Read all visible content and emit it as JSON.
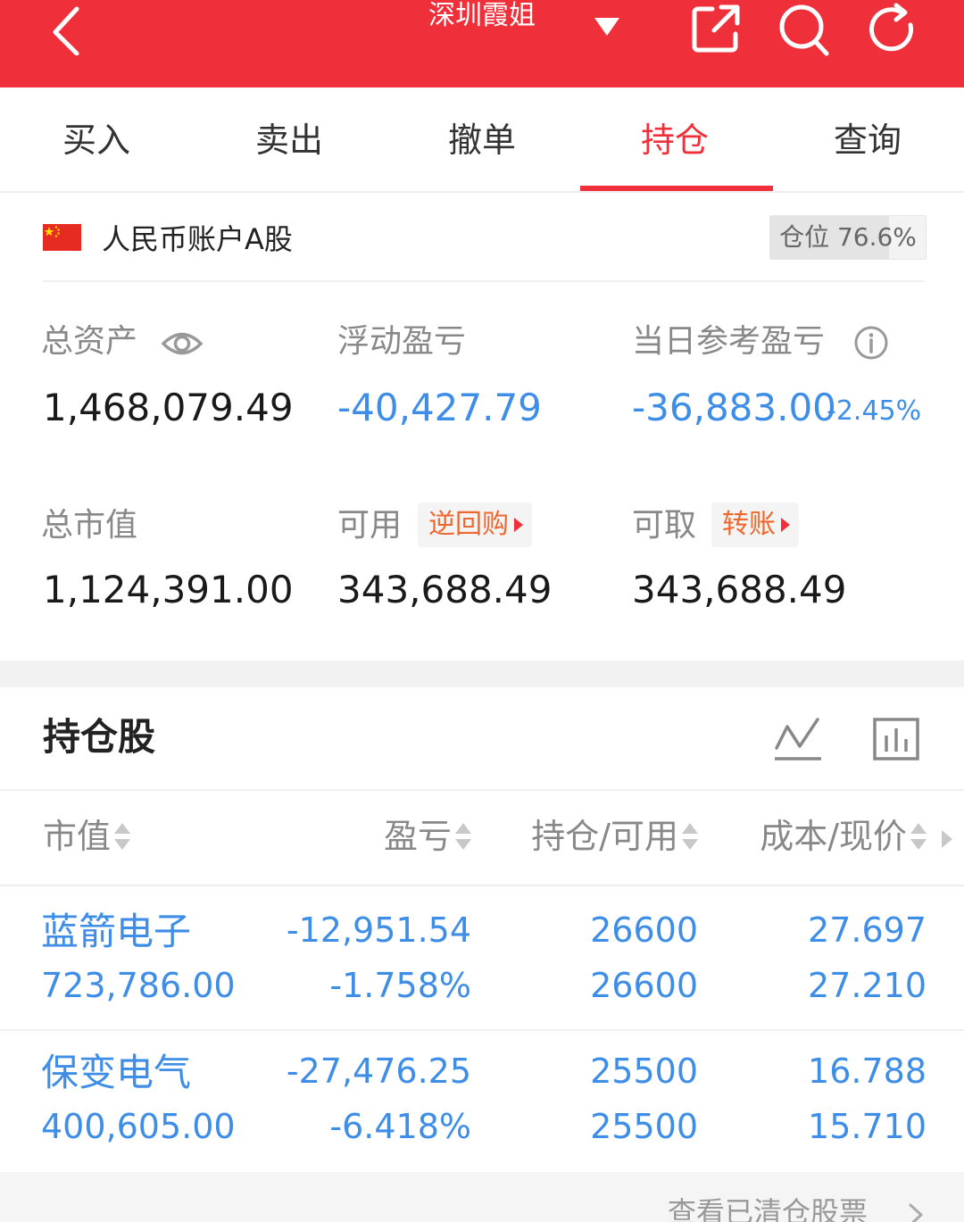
{
  "header": {
    "title": "深圳霞姐",
    "icons": [
      "back-icon",
      "caret-down-icon",
      "share-icon",
      "search-icon",
      "refresh-icon"
    ],
    "bg_color": "#ef2f3a"
  },
  "tabs": [
    {
      "label": "买入",
      "active": false
    },
    {
      "label": "卖出",
      "active": false
    },
    {
      "label": "撤单",
      "active": false
    },
    {
      "label": "持仓",
      "active": true
    },
    {
      "label": "查询",
      "active": false
    }
  ],
  "account": {
    "name": "人民币账户A股",
    "flag_icon": "china-flag-icon",
    "position_label": "仓位 76.6%",
    "position_fraction": 0.766
  },
  "stats": {
    "total_assets_label": "总资产",
    "total_assets": "1,468,079.49",
    "float_pl_label": "浮动盈亏",
    "float_pl": "-40,427.79",
    "daily_pl_label": "当日参考盈亏",
    "daily_pl": "-36,883.00",
    "daily_pl_pct": "-2.45%",
    "market_value_label": "总市值",
    "market_value": "1,124,391.00",
    "available_label": "可用",
    "repo_button": "逆回购",
    "available": "343,688.49",
    "withdrawable_label": "可取",
    "transfer_button": "转账",
    "withdrawable": "343,688.49"
  },
  "holdings": {
    "title": "持仓股",
    "columns": [
      "市值",
      "盈亏",
      "持仓/可用",
      "成本/现价"
    ],
    "rows": [
      {
        "name": "蓝箭电子",
        "market_value": "723,786.00",
        "pl": "-12,951.54",
        "pl_pct": "-1.758%",
        "holding": "26600",
        "available": "26600",
        "cost": "27.697",
        "price": "27.210"
      },
      {
        "name": "保变电气",
        "market_value": "400,605.00",
        "pl": "-27,476.25",
        "pl_pct": "-6.418%",
        "holding": "25500",
        "available": "25500",
        "cost": "16.788",
        "price": "15.710"
      }
    ]
  },
  "footer": {
    "link_label": "查看已清仓股票"
  },
  "colors": {
    "accent": "#ef2f3a",
    "loss_blue": "#3e8ee8",
    "button_text": "#f0672d"
  }
}
